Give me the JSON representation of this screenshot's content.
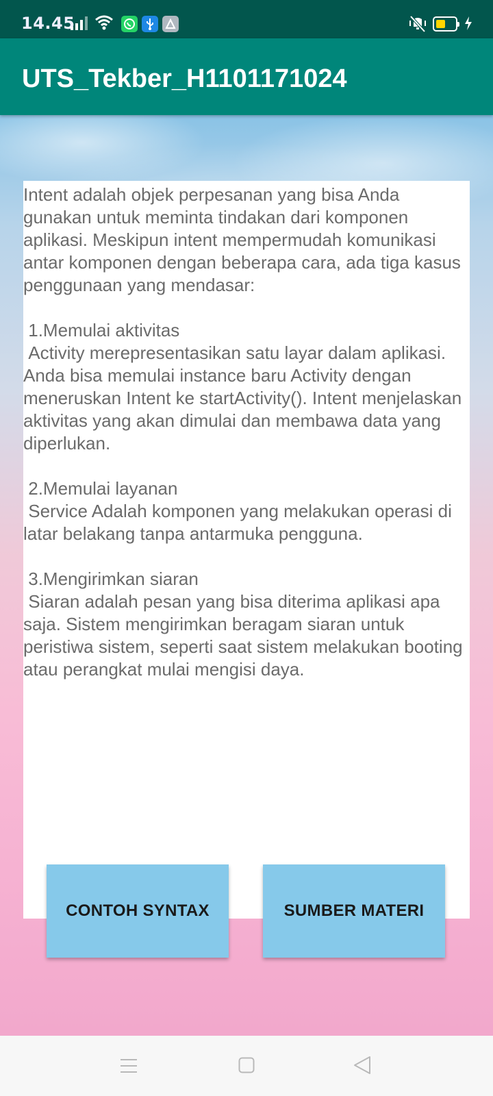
{
  "status_bar": {
    "time": "14.45"
  },
  "app_bar": {
    "title": "UTS_Tekber_H1101171024"
  },
  "content": {
    "text": "Intent adalah objek perpesanan yang bisa Anda gunakan untuk meminta tindakan dari komponen aplikasi. Meskipun intent mempermudah komunikasi antar komponen dengan beberapa cara, ada tiga kasus penggunaan yang mendasar:\n\n 1.Memulai aktivitas\n Activity merepresentasikan satu layar dalam aplikasi. Anda bisa memulai instance baru Activity dengan meneruskan Intent ke startActivity(). Intent menjelaskan aktivitas yang akan dimulai dan membawa data yang diperlukan.\n\n 2.Memulai layanan\n Service Adalah komponen yang melakukan operasi di latar belakang tanpa antarmuka pengguna.\n\n 3.Mengirimkan siaran\n Siaran adalah pesan yang bisa diterima aplikasi apa saja. Sistem mengirimkan beragam siaran untuk peristiwa sistem, seperti saat sistem melakukan booting atau perangkat mulai mengisi daya."
  },
  "buttons": {
    "left_label": "CONTOH SYNTAX",
    "right_label": "SUMBER MATERI"
  },
  "colors": {
    "status_bar": "#02564d",
    "app_bar": "#00867a",
    "button": "#86c9ea",
    "battery": "#ffd600"
  }
}
